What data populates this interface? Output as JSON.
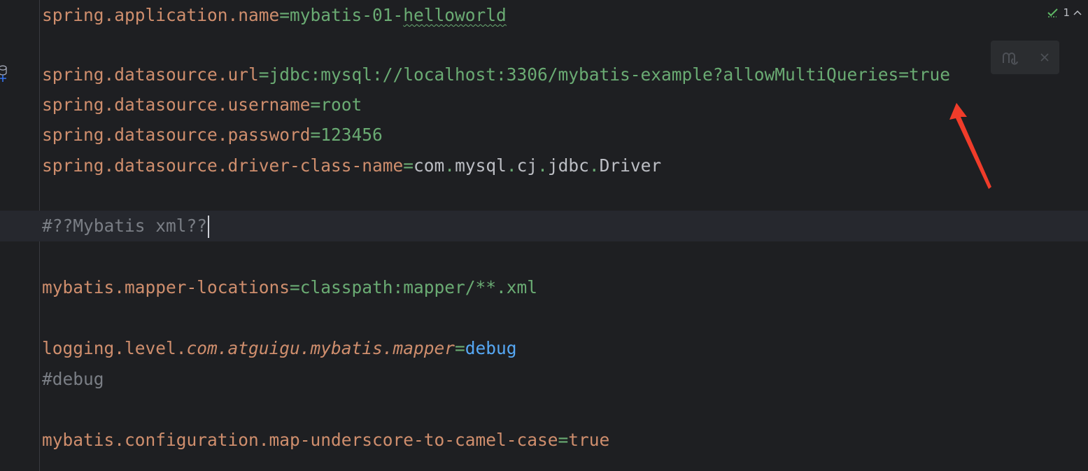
{
  "editor": {
    "lines": [
      {
        "key": "spring.application.name",
        "eq": "=",
        "v1": "mybatis-01-",
        "v2": "helloworld"
      },
      {
        "key": "spring.datasource.url",
        "eq": "=",
        "value": "jdbc:mysql://localhost:3306/mybatis-example?allowMultiQueries=true"
      },
      {
        "key": "spring.datasource.username",
        "eq": "=",
        "value": "root"
      },
      {
        "key": "spring.datasource.password",
        "eq": "=",
        "value": "123456"
      },
      {
        "key": "spring.datasource.driver-class-name",
        "eq": "=",
        "p1": "com",
        "dot1": ".",
        "p2": "mysql",
        "dot2": ".",
        "p3": "cj",
        "dot3": ".",
        "p4": "jdbc",
        "dot4": ".",
        "p5": "Driver"
      },
      {
        "comment": "#??Mybatis xml??"
      },
      {
        "key": "mybatis.mapper-locations",
        "eq": "=",
        "value": "classpath:mapper/**.xml"
      },
      {
        "key": "logging.level.",
        "key_italic": "com.atguigu.mybatis.mapper",
        "eq": "=",
        "value": "debug"
      },
      {
        "comment": "#debug"
      },
      {
        "key": "mybatis.configuration.map-underscore-to-camel-case",
        "eq": "=",
        "value": "true"
      }
    ]
  },
  "inspection": {
    "count": "1",
    "check_icon": "check-icon",
    "arrow_icon": "chevron-up-icon"
  },
  "floating_toolbar": {
    "icon": "reader-mode-icon",
    "close_icon": "close-icon"
  },
  "colors": {
    "background": "#1e1f22",
    "key": "#cf8e6d",
    "string": "#6aab73",
    "comment": "#7a7e85",
    "keyword_value": "#56a8f5",
    "plain": "#bcbec4",
    "annotation_arrow": "#f03c2a"
  }
}
